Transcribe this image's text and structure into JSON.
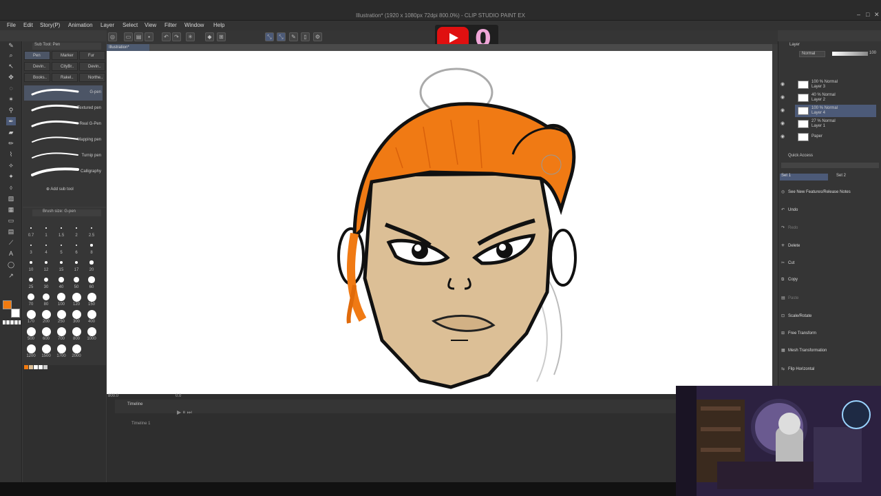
{
  "window": {
    "title": "Illustration* (1920 x 1080px 72dpi 800.0%) - CLIP STUDIO PAINT EX"
  },
  "menu": [
    "File",
    "Edit",
    "Story(P)",
    "Animation",
    "Layer",
    "Select",
    "View",
    "Filter",
    "Window",
    "Help"
  ],
  "overlay": {
    "youtube_count": "0"
  },
  "document_tab": "Illustration*",
  "sub_tool": {
    "header": "Sub Tool: Pen",
    "tabs": [
      "Pen",
      "Marker",
      "Fur",
      "Devin..",
      "CityBr..",
      "Devin..",
      "Books..",
      "Rakel..",
      "Northe.."
    ],
    "brushes": [
      "G-pen",
      "Textured pen",
      "Real G-Pen",
      "Mapping pen",
      "Turnip pen",
      "Calligraphy"
    ],
    "add_label": "Add sub tool"
  },
  "brush_size": {
    "header": "Brush size: G-pen",
    "values": [
      "0.7",
      "1",
      "1.5",
      "2",
      "2.5",
      "3",
      "4",
      "5",
      "6",
      "8",
      "10",
      "12",
      "15",
      "17",
      "20",
      "25",
      "30",
      "40",
      "50",
      "60",
      "70",
      "80",
      "100",
      "120",
      "150",
      "170",
      "200",
      "250",
      "300",
      "400",
      "500",
      "600",
      "700",
      "800",
      "1000",
      "1200",
      "1500",
      "1700",
      "2000"
    ]
  },
  "canvas_status": {
    "zoom": "800.0",
    "angle": "0.0"
  },
  "timeline": {
    "header": "Timeline",
    "track": "Timeline 1"
  },
  "layer_panel": {
    "header": "Layer",
    "blend": "Normal",
    "opacity": "100",
    "layers": [
      {
        "opacity": "100 % Normal",
        "name": "Layer 3"
      },
      {
        "opacity": "40 % Normal",
        "name": "Layer 2"
      },
      {
        "opacity": "100 % Normal",
        "name": "Layer 4"
      },
      {
        "opacity": "27 % Normal",
        "name": "Layer 1"
      },
      {
        "opacity": "",
        "name": "Paper"
      }
    ]
  },
  "quick_access": {
    "header": "Quick Access",
    "sets": [
      "Set 1",
      "Set 2"
    ],
    "items": [
      {
        "label": "See New Features/Release Notes",
        "enabled": true
      },
      {
        "label": "Undo",
        "enabled": true
      },
      {
        "label": "Redo",
        "enabled": false
      },
      {
        "label": "Delete",
        "enabled": true
      },
      {
        "label": "Cut",
        "enabled": true
      },
      {
        "label": "Copy",
        "enabled": true
      },
      {
        "label": "Paste",
        "enabled": false
      },
      {
        "label": "Scale/Rotate",
        "enabled": true
      },
      {
        "label": "Free Transform",
        "enabled": true
      },
      {
        "label": "Mesh Transformation",
        "enabled": true
      },
      {
        "label": "Flip Horizontal",
        "enabled": true
      }
    ]
  },
  "colors": {
    "main": "#f07a10",
    "sub": "#ffffff",
    "hair": "#f07a14",
    "skin": "#dcbf96"
  }
}
